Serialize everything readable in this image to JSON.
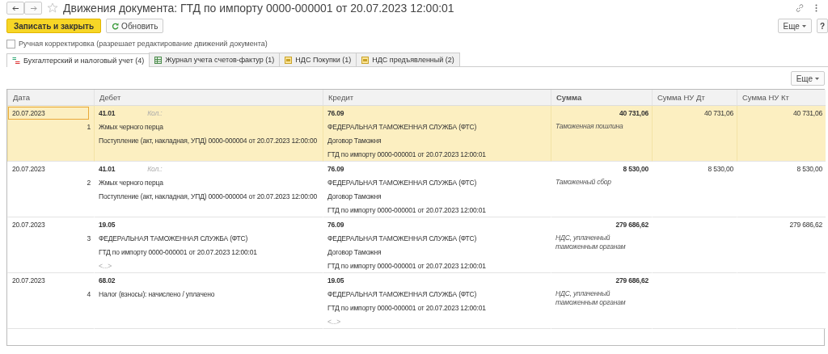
{
  "header": {
    "title": "Движения документа: ГТД по импорту 0000-000001 от 20.07.2023 12:00:01",
    "favorite": false
  },
  "toolbar": {
    "save_button": "Записать и закрыть",
    "refresh_button": "Обновить",
    "more_button": "Еще",
    "help_button": "?"
  },
  "manual_correction": {
    "label": "Ручная корректировка (разрешает редактирование движений документа)",
    "checked": false
  },
  "tabs": [
    {
      "label": "Бухгалтерский и налоговый учет (4)",
      "selected": true,
      "kind": "accounting"
    },
    {
      "label": "Журнал учета счетов-фактур (1)",
      "selected": false,
      "kind": "journal"
    },
    {
      "label": "НДС Покупки (1)",
      "selected": false,
      "kind": "register"
    },
    {
      "label": "НДС предъявленный (2)",
      "selected": false,
      "kind": "register"
    }
  ],
  "table_more_button": "Еще",
  "table": {
    "columns": [
      "Дата",
      "Дебет",
      "Кредит",
      "Сумма",
      "Сумма НУ Дт",
      "Сумма НУ Кт"
    ],
    "rows": [
      {
        "selected": true,
        "date": "20.07.2023",
        "number": "1",
        "debit": {
          "account": "41.01",
          "qty_label": "Кол.:",
          "lines": [
            "Жмых черного перца",
            "Поступление (акт, накладная, УПД) 0000-000004 от 20.07.2023 12:00:00"
          ]
        },
        "credit": {
          "account": "76.09",
          "lines": [
            "ФЕДЕРАЛЬНАЯ ТАМОЖЕННАЯ СЛУЖБА (ФТС)",
            "Договор Таможня",
            "ГТД по импорту 0000-000001 от 20.07.2023 12:00:01"
          ]
        },
        "sum": "40 731,06",
        "sum_note": "Таможенная пошлина",
        "sum_nu_dt": "40 731,06",
        "sum_nu_kt": "40 731,06"
      },
      {
        "selected": false,
        "date": "20.07.2023",
        "number": "2",
        "debit": {
          "account": "41.01",
          "qty_label": "Кол.:",
          "lines": [
            "Жмых черного перца",
            "Поступление (акт, накладная, УПД) 0000-000004 от 20.07.2023 12:00:00"
          ]
        },
        "credit": {
          "account": "76.09",
          "lines": [
            "ФЕДЕРАЛЬНАЯ ТАМОЖЕННАЯ СЛУЖБА (ФТС)",
            "Договор Таможня",
            "ГТД по импорту 0000-000001 от 20.07.2023 12:00:01"
          ]
        },
        "sum": "8 530,00",
        "sum_note": "Таможенный сбор",
        "sum_nu_dt": "8 530,00",
        "sum_nu_kt": "8 530,00"
      },
      {
        "selected": false,
        "date": "20.07.2023",
        "number": "3",
        "debit": {
          "account": "19.05",
          "lines": [
            "ФЕДЕРАЛЬНАЯ ТАМОЖЕННАЯ СЛУЖБА (ФТС)",
            "ГТД по импорту 0000-000001 от 20.07.2023 12:00:01"
          ],
          "more": "<...>"
        },
        "credit": {
          "account": "76.09",
          "lines": [
            "ФЕДЕРАЛЬНАЯ ТАМОЖЕННАЯ СЛУЖБА (ФТС)",
            "Договор Таможня",
            "ГТД по импорту 0000-000001 от 20.07.2023 12:00:01"
          ]
        },
        "sum": "279 686,62",
        "sum_note": "НДС, уплаченный таможенным органам",
        "sum_nu_kt": "279 686,62"
      },
      {
        "selected": false,
        "date": "20.07.2023",
        "number": "4",
        "debit": {
          "account": "68.02",
          "lines": [
            "Налог (взносы): начислено / уплачено"
          ]
        },
        "credit": {
          "account": "19.05",
          "lines": [
            "ФЕДЕРАЛЬНАЯ ТАМОЖЕННАЯ СЛУЖБА (ФТС)",
            "ГТД по импорту 0000-000001 от 20.07.2023 12:00:01"
          ],
          "more": "<...>"
        },
        "sum": "279 686,62",
        "sum_note": "НДС, уплаченный таможенным органам"
      }
    ]
  }
}
